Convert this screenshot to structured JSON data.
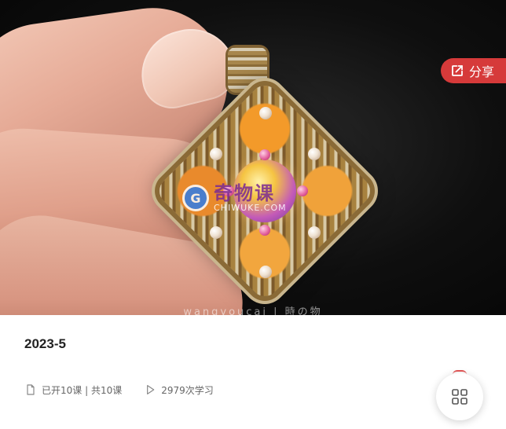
{
  "hero": {
    "caption": "wangyoucai | 時の物",
    "watermark": {
      "cn": "奇物课",
      "en": "CHIWUKE.COM"
    }
  },
  "share": {
    "label": "分享",
    "icon": "share-icon"
  },
  "course": {
    "title": "2023-5"
  },
  "meta": {
    "lessons": {
      "icon": "document-icon",
      "text": "已开10课 | 共10课"
    },
    "views": {
      "icon": "play-icon",
      "text": "2979次学习"
    }
  },
  "fab": {
    "icon": "grid-menu-icon"
  },
  "colors": {
    "accent": "#d63a3a",
    "title": "#222222",
    "meta": "#666666"
  }
}
